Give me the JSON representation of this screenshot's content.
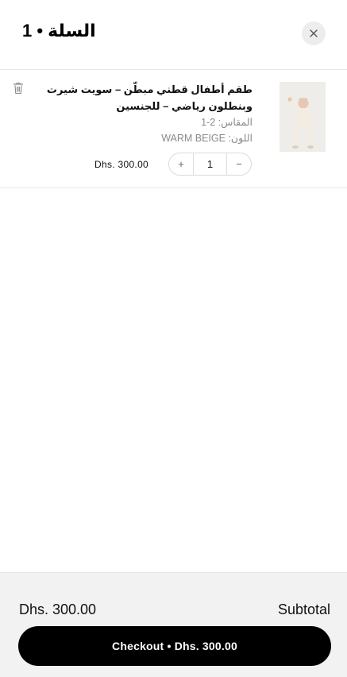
{
  "header": {
    "title": "السلة • 1",
    "close_icon": "close-icon"
  },
  "cart_item": {
    "name": "طقم أطفال قطني مبطّن – سويت شيرت وبنطلون رياضي – للجنسين",
    "size": "المقاس: 2-1",
    "color": "اللون: WARM BEIGE",
    "price": "Dhs. 300.00",
    "quantity": "1",
    "increment_label": "+",
    "decrement_label": "−",
    "remove_icon": "trash-icon"
  },
  "footer": {
    "subtotal_label": "Subtotal",
    "subtotal_amount": "Dhs. 300.00",
    "checkout_label": "Checkout • Dhs. 300.00"
  }
}
